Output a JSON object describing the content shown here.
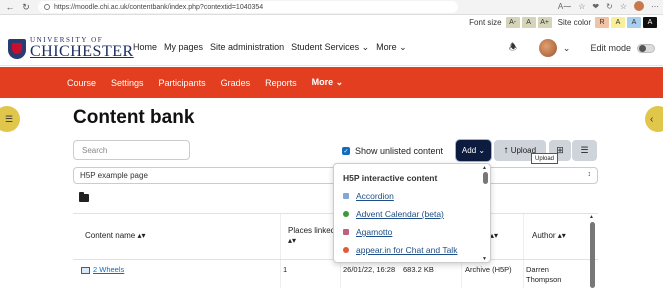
{
  "browser": {
    "url": "https://moodle.chi.ac.uk/contentbank/index.php?contextid=1040354"
  },
  "a11y": {
    "font_size_label": "Font size",
    "font_chips": [
      "A-",
      "A",
      "A+"
    ],
    "site_color_label": "Site color",
    "color_chips": [
      {
        "label": "R",
        "bg": "#f2c2a5",
        "fg": "#333333"
      },
      {
        "label": "A",
        "bg": "#f7ef9a",
        "fg": "#333333"
      },
      {
        "label": "A",
        "bg": "#a9cfee",
        "fg": "#333333"
      },
      {
        "label": "A",
        "bg": "#111111",
        "fg": "#ffffff"
      }
    ]
  },
  "header": {
    "logo_top": "UNIVERSITY OF",
    "logo_main": "CHICHESTER",
    "nav": [
      "Home",
      "My pages",
      "Site administration",
      "Student Services ⌄",
      "More ⌄"
    ],
    "edit_mode_label": "Edit mode"
  },
  "course_nav": {
    "items": [
      "Course",
      "Settings",
      "Participants",
      "Grades",
      "Reports"
    ],
    "active": "More ⌄"
  },
  "main": {
    "title": "Content bank",
    "search_placeholder": "Search",
    "show_unlisted_label": "Show unlisted content",
    "add_label": "Add ⌄",
    "upload_label": "Upload",
    "upload_tooltip": "Upload",
    "context_select": "H5P example page"
  },
  "dropdown": {
    "header": "H5P interactive content",
    "items": [
      {
        "label": "Accordion",
        "color": "#7fa8d8"
      },
      {
        "label": "Advent Calendar (beta)",
        "color": "#3a9a3a"
      },
      {
        "label": "Agamotto",
        "color": "#c0607f"
      },
      {
        "label": "appear.in for Chat and Talk",
        "color": "#e25a3a"
      }
    ]
  },
  "table": {
    "headers": {
      "content_name": "Content name ▴▾",
      "places_linked": "Places linked ▴▾",
      "type_sort": "▴▾",
      "author": "Author ▴▾"
    },
    "rows": [
      {
        "name": "2 Wheels",
        "places": "1",
        "modified": "26/01/22, 16:28",
        "size": "683.2 KB",
        "type": "Archive (H5P)",
        "author": "Darren Thompson"
      }
    ]
  },
  "colors": {
    "course_nav_bg": "#e23e1f",
    "add_button_bg": "#0d1b3e",
    "link": "#0f6cbf",
    "drawer": "#e0c64a"
  }
}
